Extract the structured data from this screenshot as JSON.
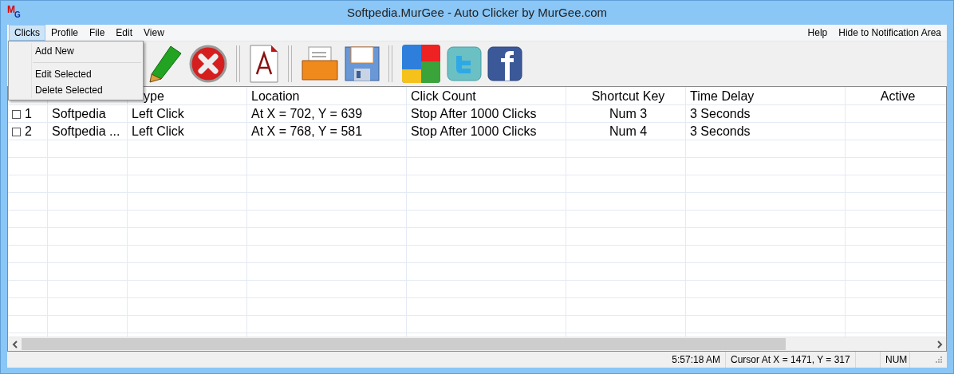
{
  "window": {
    "title": "Softpedia.MurGee - Auto Clicker by MurGee.com",
    "logo": [
      "M",
      "G"
    ]
  },
  "menu_bar": {
    "left": [
      {
        "label": "Clicks",
        "selected": true
      },
      {
        "label": "Profile",
        "selected": false
      },
      {
        "label": "File",
        "selected": false
      },
      {
        "label": "Edit",
        "selected": false
      },
      {
        "label": "View",
        "selected": false
      }
    ],
    "right": [
      {
        "label": "Help",
        "selected": false
      },
      {
        "label": "Hide to Notification Area",
        "selected": false
      }
    ]
  },
  "open_menu": {
    "items": [
      {
        "kind": "item",
        "label": "Add New"
      },
      {
        "kind": "separator"
      },
      {
        "kind": "item",
        "label": "Edit Selected"
      },
      {
        "kind": "item",
        "label": "Delete Selected"
      }
    ]
  },
  "table": {
    "columns": [
      {
        "label": "ype"
      },
      {
        "label": "Location"
      },
      {
        "label": "Click Count"
      },
      {
        "label": "Shortcut Key"
      },
      {
        "label": "Time Delay"
      },
      {
        "label": "Active"
      }
    ],
    "rows": [
      {
        "checked": false,
        "number": "1",
        "name": "Softpedia",
        "type": "Left Click",
        "location": "At X = 702, Y = 639",
        "click_count": "Stop After 1000 Clicks",
        "shortcut_key": "Num 3",
        "time_delay": "3 Seconds"
      },
      {
        "checked": false,
        "number": "2",
        "name": "Softpedia ...",
        "type": "Left Click",
        "location": "At X = 768, Y = 581",
        "click_count": "Stop After 1000 Clicks",
        "shortcut_key": "Num 4",
        "time_delay": "3 Seconds"
      }
    ]
  },
  "status_bar": {
    "time": "5:57:18 AM",
    "cursor": "Cursor At X = 1471, Y = 317",
    "num_lock": "NUM"
  }
}
